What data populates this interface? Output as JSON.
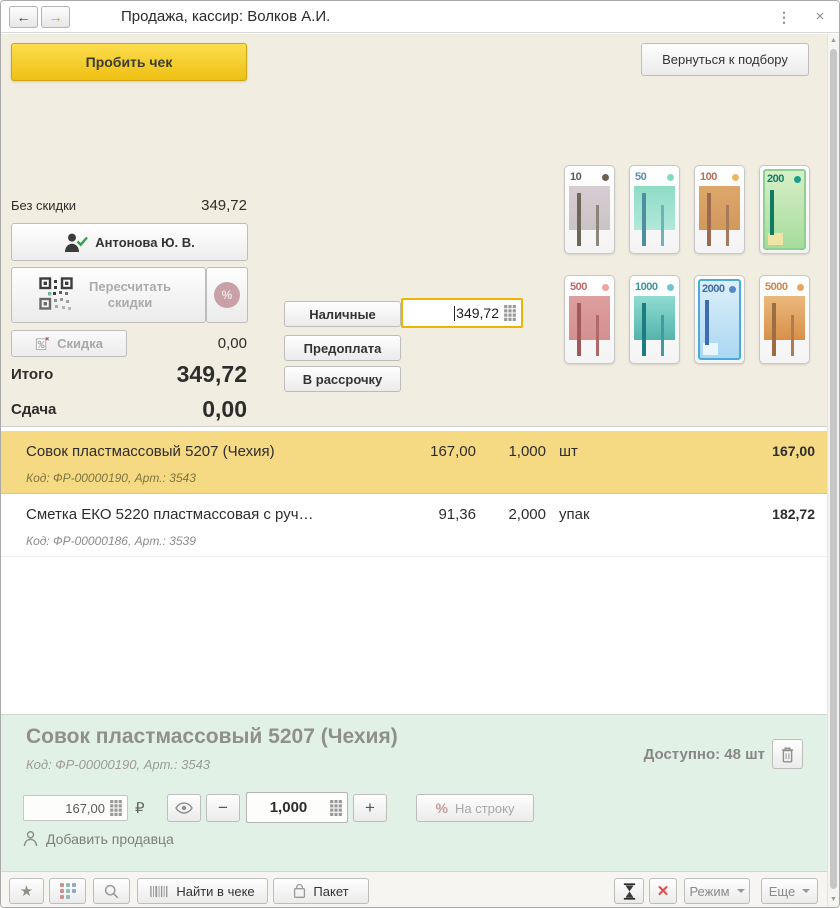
{
  "window": {
    "title": "Продажа, кассир: Волков А.И."
  },
  "icons": {
    "back": "←",
    "forward": "→",
    "menu": "⋮",
    "close": "×",
    "star": "★",
    "clear": "✕",
    "minus": "−",
    "plus": "+"
  },
  "header": {
    "punch_check": "Пробить чек",
    "return_to_selection": "Вернуться к подбору"
  },
  "payment": {
    "no_discount_label": "Без скидки",
    "no_discount_value": "349,72",
    "customer_name": "Антонова Ю. В.",
    "recalc_discounts_label": "Пересчитать скидки",
    "percent_badge": "%",
    "discount_button": "Скидка",
    "discount_value": "0,00",
    "total_label": "Итого",
    "total_value": "349,72",
    "change_label": "Сдача",
    "change_value": "0,00",
    "method_cash": "Наличные",
    "method_prepay": "Предоплата",
    "method_installment": "В рассрочку",
    "amount_value": "349,72"
  },
  "banknotes": [
    {
      "value": "10",
      "style": "classic",
      "num": "#5a5a5a",
      "dot": "#6f5f4e",
      "fill_top": "#d7ccd2",
      "fill_bottom": "#cac4c6",
      "bar1": "#6e6757",
      "bar2": "#8c867a"
    },
    {
      "value": "50",
      "style": "classic",
      "num": "#5f8fa8",
      "dot": "#7fdcc4",
      "fill_top": "#8edcc6",
      "fill_bottom": "#b2e8da",
      "bar1": "#4f8e9e",
      "bar2": "#6fb2b8"
    },
    {
      "value": "100",
      "style": "classic",
      "num": "#b4705c",
      "dot": "#edb667",
      "fill_top": "#dda76c",
      "fill_bottom": "#d1995c",
      "bar1": "#9c6a4c",
      "bar2": "#a87a5c"
    },
    {
      "value": "200",
      "style": "modern",
      "num": "#0e7f63",
      "dot": "#16a085",
      "border": "#8fcf8f",
      "fill_top": "#d8efc8",
      "fill_bottom": "#a5dc9b",
      "bar1": "#0f7a60",
      "block": "#efe4a6"
    },
    {
      "value": "500",
      "style": "classic",
      "num": "#c06868",
      "dot": "#eba3a3",
      "fill_top": "#dc9e9e",
      "fill_bottom": "#d39090",
      "bar1": "#a25858",
      "bar2": "#b06868"
    },
    {
      "value": "1000",
      "style": "classic",
      "num": "#3f9399",
      "dot": "#6cc8cc",
      "fill_top": "#90dbd2",
      "fill_bottom": "#54b4ac",
      "bar1": "#1b7d80",
      "bar2": "#3f9da0"
    },
    {
      "value": "2000",
      "style": "modern",
      "num": "#3a6ba6",
      "dot": "#5488c8",
      "border": "#49aade",
      "fill_top": "#ddeffa",
      "fill_bottom": "#abd7f2",
      "bar1": "#3e6cb2",
      "block": "#eaf6fd"
    },
    {
      "value": "5000",
      "style": "classic",
      "num": "#c9894e",
      "dot": "#e9a75e",
      "fill_top": "#eab97d",
      "fill_bottom": "#d89048",
      "bar1": "#9c6c42",
      "bar2": "#b07c50"
    }
  ],
  "receipt": {
    "rows": [
      {
        "selected": true,
        "name": "Совок пластмассовый 5207 (Чехия)",
        "price": "167,00",
        "qty": "1,000",
        "unit": "шт",
        "total": "167,00",
        "code": "Код: ФР-00000190, Арт.: 3543"
      },
      {
        "selected": false,
        "name": "Сметка ЕКО 5220 пластмассовая с руч…",
        "price": "91,36",
        "qty": "2,000",
        "unit": "упак",
        "total": "182,72",
        "code": "Код: ФР-00000186, Арт.: 3539"
      }
    ]
  },
  "detail": {
    "title": "Совок пластмассовый 5207 (Чехия)",
    "code": "Код: ФР-00000190, Арт.: 3543",
    "available": "Доступно: 48 шт",
    "price_value": "167,00",
    "currency": "₽",
    "qty_value": "1,000",
    "percent": "%",
    "per_line": "На строку",
    "add_seller": "Добавить продавца"
  },
  "toolbar": {
    "find_in_check": "Найти в чеке",
    "package": "Пакет",
    "mode": "Режим",
    "more": "Еще"
  },
  "colors": {
    "accent_yellow": "#f0c424",
    "panel_beige": "#f1ede0",
    "selected_row": "#f6d983",
    "detail_green": "#e2f1e6",
    "focus_border": "#efb400",
    "success_green": "#2ea44f",
    "danger_red": "#e04b4b"
  }
}
